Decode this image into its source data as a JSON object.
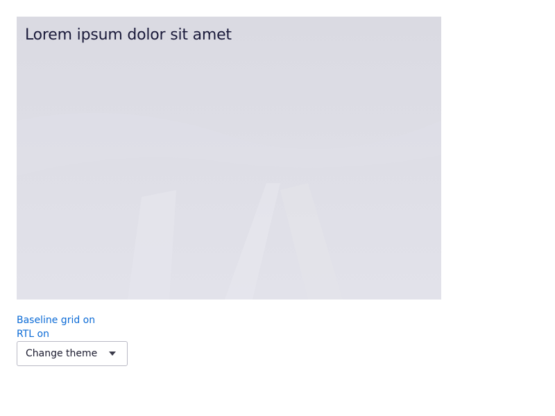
{
  "hero": {
    "title": "Lorem ipsum dolor sit amet"
  },
  "toggles": {
    "baseline_grid": "Baseline grid on",
    "rtl": "RTL on"
  },
  "theme_menu": {
    "label": "Change theme",
    "icon": "caret-down-icon"
  },
  "colors": {
    "link": "#0a6ad6",
    "hero_overlay": "#dcdce4",
    "title_text": "#1a1a3a"
  }
}
